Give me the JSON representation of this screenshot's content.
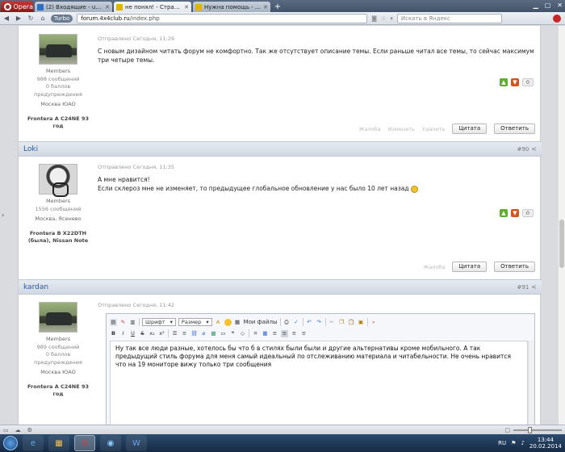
{
  "browser": {
    "menu_label": "Opera",
    "tabs": [
      {
        "label": "(2) Входящие - unital...",
        "active": false,
        "color": "#2a6fc2"
      },
      {
        "label": "не понял! - Страница ...",
        "active": true,
        "color": "#e0b400"
      },
      {
        "label": "Нужна помощь - Стр...",
        "active": false,
        "color": "#e0b400"
      }
    ],
    "turbo_label": "Turbo",
    "url_host": "forum.4x4club.ru",
    "url_path": "/index.php",
    "search_placeholder": "Искать в Яндекс"
  },
  "posts": [
    {
      "author_role": "Members",
      "author_posts": "988 сообщений",
      "author_warnings": "0 баллов предупреждения",
      "author_location": "Москва ЮАО",
      "author_car": "Frontera A C24NE 93 год",
      "date": "Отправлено Сегодня, 11:29",
      "message": " С новым дизайном читать форум не комфортно. Так же  отсутствует описание темы. Если раньше читал все темы, то сейчас максимум три четыре темы.",
      "rating": "0",
      "action_report": "Жалоба",
      "action_edit": "Изменить",
      "action_delete": "Удалить",
      "action_quote": "Цитата",
      "action_reply": "Ответить"
    },
    {
      "author_name": "Loki",
      "post_number": "#90",
      "author_role": "Members",
      "author_posts": "1556 сообщений",
      "author_location": "Москва, Ясенево",
      "author_car": "Frontera B X22DTH (была), Nissan Note",
      "date": "Отправлено Сегодня, 11:35",
      "message_line1": "А мне нравится!",
      "message_line2": "Если склероз мне не изменяет, то предыдущее глобальное обновление у нас было 10 лет назад",
      "rating": "0",
      "action_report": "Жалоба",
      "action_quote": "Цитата",
      "action_reply": "Ответить"
    },
    {
      "author_name": "kardan",
      "post_number": "#91",
      "author_role": "Members",
      "author_posts": "989 сообщений",
      "author_warnings": "0 баллов предупреждения",
      "author_location": "Москва ЮАО",
      "author_car": "Frontera A C24NE 93 год",
      "date": "Отправлено Сегодня, 11:42"
    }
  ],
  "editor": {
    "font_label": "Шрифт",
    "size_label": "Размер",
    "files_label": "Мои файлы",
    "text": "Ну так все люди разные, хотелось бы что б в стилях были были и другие альтернативы кроме мобильного. А так предыдущий стиль форума для меня самый идеальный по отслеживанию материала и читабельности. Не очень нравится что на 19 мониторе  вижу только три сообщения"
  },
  "taskbar": {
    "lang": "RU",
    "time": "13:44",
    "date": "20.02.2014"
  },
  "colors": {
    "link": "#2a5a9a",
    "rate_up": "#5fae2e",
    "rate_down": "#d6521e"
  }
}
